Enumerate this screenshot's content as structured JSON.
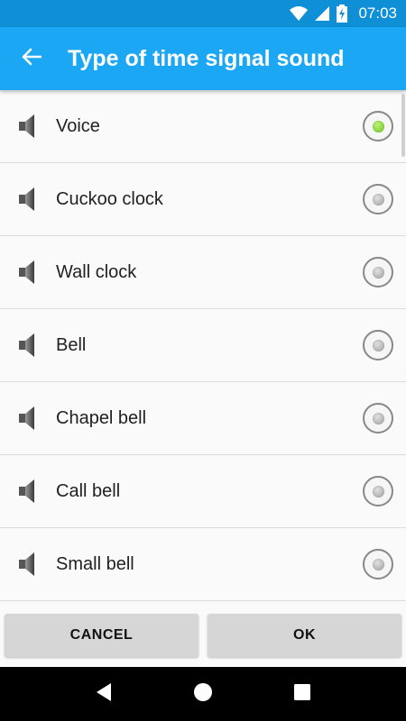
{
  "status_bar": {
    "time": "07:03",
    "icons": [
      "wifi-icon",
      "cellular-signal-icon",
      "battery-charging-icon"
    ]
  },
  "app_bar": {
    "title": "Type of time signal sound",
    "back_icon": "arrow-back-icon"
  },
  "list": {
    "items": [
      {
        "label": "Voice",
        "icon": "speaker-icon",
        "selected": true
      },
      {
        "label": "Cuckoo clock",
        "icon": "speaker-icon",
        "selected": false
      },
      {
        "label": "Wall clock",
        "icon": "speaker-icon",
        "selected": false
      },
      {
        "label": "Bell",
        "icon": "speaker-icon",
        "selected": false
      },
      {
        "label": "Chapel bell",
        "icon": "speaker-icon",
        "selected": false
      },
      {
        "label": "Call bell",
        "icon": "speaker-icon",
        "selected": false
      },
      {
        "label": "Small bell",
        "icon": "speaker-icon",
        "selected": false
      }
    ]
  },
  "buttons": {
    "cancel_label": "CANCEL",
    "ok_label": "OK"
  },
  "nav_bar": {
    "icons": [
      "back-triangle-icon",
      "home-circle-icon",
      "recents-square-icon"
    ]
  },
  "colors": {
    "status_bar": "#0e8fd6",
    "app_bar": "#1ba7f3",
    "selected_radio": "#6cc21d",
    "button_bg": "#d6d6d6"
  }
}
